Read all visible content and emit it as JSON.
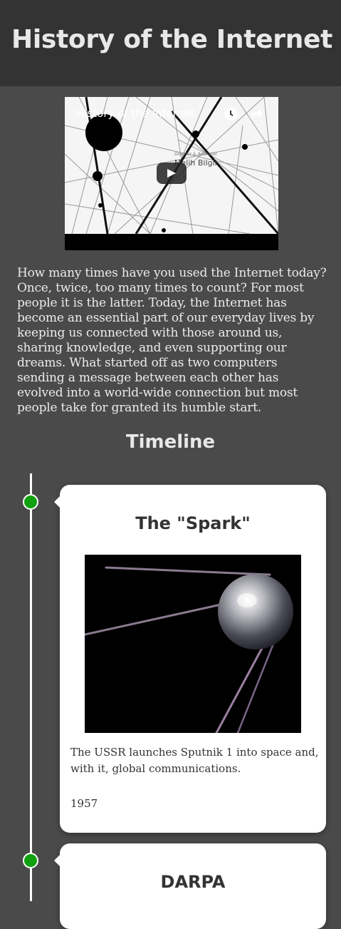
{
  "header": {
    "title": "History of the Internet"
  },
  "video": {
    "title": "History of the Internet",
    "credit_role": "Director & Animator",
    "credit_name": "Melih Bilgil",
    "icons": [
      "watch-later-icon",
      "share-icon",
      "play-icon"
    ]
  },
  "intro": {
    "text": "How many times have you used the Internet today? Once, twice, too many times to count? For most people it is the latter. Today, the Internet has become an essential part of our everyday lives by keeping us connected with those around us, sharing knowledge, and even supporting our dreams. What started off as two computers sending a message between each other has evolved into a world-wide connection but most people take for granted its humble start."
  },
  "timeline": {
    "heading": "Timeline",
    "accent_color": "#10a010",
    "events": [
      {
        "title": "The \"Spark\"",
        "description": "The USSR launches Sputnik 1 into space and, with it, global communications.",
        "date": "1957"
      },
      {
        "title": "DARPA"
      }
    ]
  }
}
